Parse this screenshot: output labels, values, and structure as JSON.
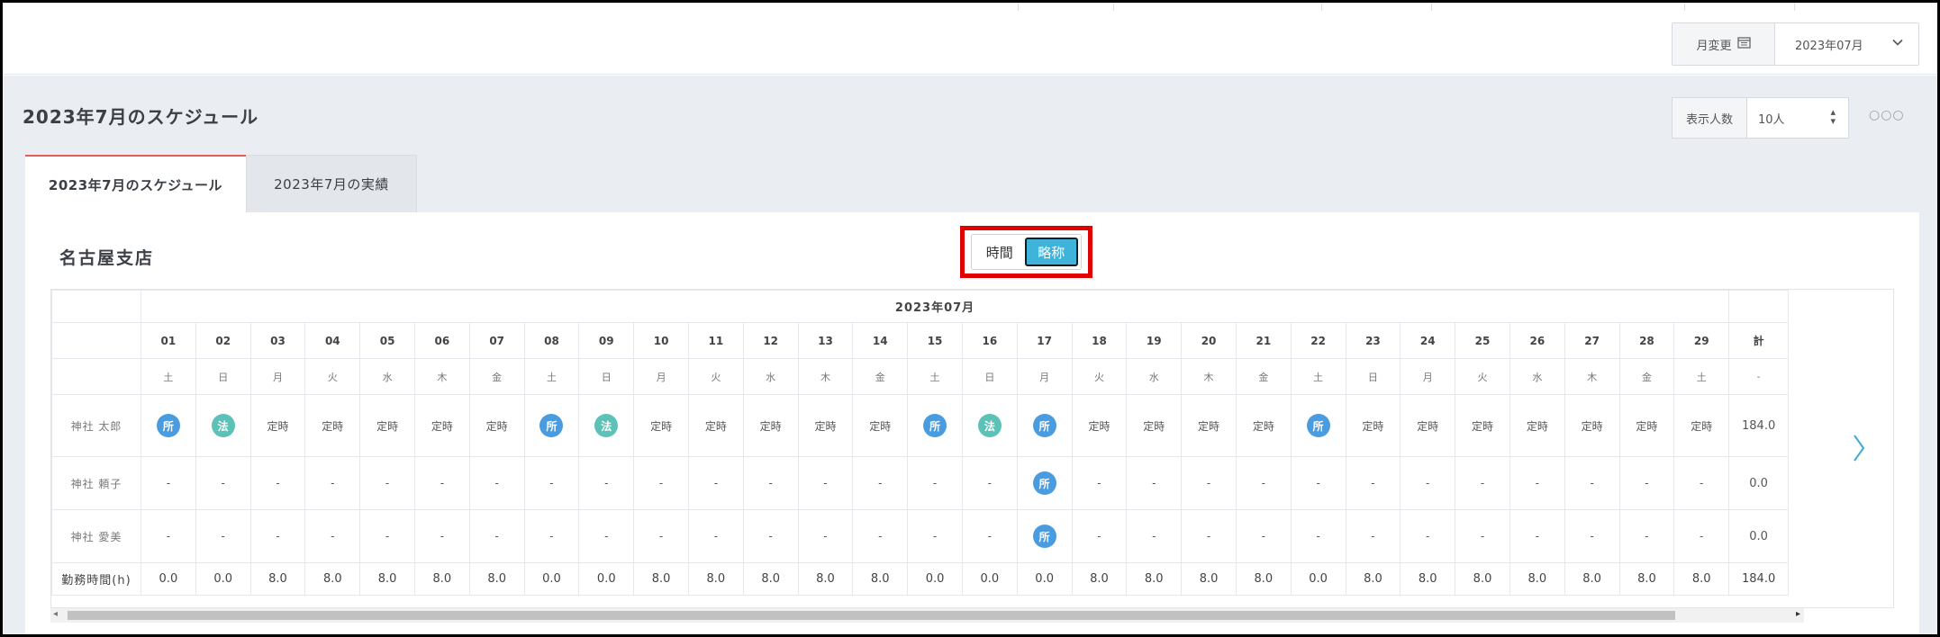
{
  "month_selector": {
    "label": "月変更",
    "value": "2023年07月"
  },
  "panel": {
    "title": "2023年7月のスケジュール"
  },
  "display_count": {
    "label": "表示人数",
    "value": "10人"
  },
  "tabs": [
    {
      "label": "2023年7月のスケジュール",
      "active": true
    },
    {
      "label": "2023年7月の実績",
      "active": false
    }
  ],
  "branch_name": "名古屋支店",
  "toggle": {
    "time_label": "時間",
    "abbr_label": "略称",
    "selected": "略称"
  },
  "table": {
    "month_header": "2023年07月",
    "total_header": "計",
    "days": [
      "01",
      "02",
      "03",
      "04",
      "05",
      "06",
      "07",
      "08",
      "09",
      "10",
      "11",
      "12",
      "13",
      "14",
      "15",
      "16",
      "17",
      "18",
      "19",
      "20",
      "21",
      "22",
      "23",
      "24",
      "25",
      "26",
      "27",
      "28",
      "29"
    ],
    "weekdays": [
      "土",
      "日",
      "月",
      "火",
      "水",
      "木",
      "金",
      "土",
      "日",
      "月",
      "火",
      "水",
      "木",
      "金",
      "土",
      "日",
      "月",
      "火",
      "水",
      "木",
      "金",
      "土",
      "日",
      "月",
      "火",
      "水",
      "木",
      "金",
      "土"
    ],
    "weekday_total": "-",
    "rows": [
      {
        "name": "神社 太郎",
        "cells": [
          "所",
          "法",
          "定時",
          "定時",
          "定時",
          "定時",
          "定時",
          "所",
          "法",
          "定時",
          "定時",
          "定時",
          "定時",
          "定時",
          "所",
          "法",
          "所",
          "定時",
          "定時",
          "定時",
          "定時",
          "所",
          "定時",
          "定時",
          "定時",
          "定時",
          "定時",
          "定時",
          "定時"
        ],
        "total": "184.0"
      },
      {
        "name": "神社 頼子",
        "cells": [
          "-",
          "-",
          "-",
          "-",
          "-",
          "-",
          "-",
          "-",
          "-",
          "-",
          "-",
          "-",
          "-",
          "-",
          "-",
          "-",
          "所",
          "-",
          "-",
          "-",
          "-",
          "-",
          "-",
          "-",
          "-",
          "-",
          "-",
          "-",
          "-"
        ],
        "total": "0.0"
      },
      {
        "name": "神社 愛美",
        "cells": [
          "-",
          "-",
          "-",
          "-",
          "-",
          "-",
          "-",
          "-",
          "-",
          "-",
          "-",
          "-",
          "-",
          "-",
          "-",
          "-",
          "所",
          "-",
          "-",
          "-",
          "-",
          "-",
          "-",
          "-",
          "-",
          "-",
          "-",
          "-",
          "-"
        ],
        "total": "0.0"
      }
    ],
    "hours_row": {
      "label": "勤務時間(h)",
      "values": [
        "0.0",
        "0.0",
        "8.0",
        "8.0",
        "8.0",
        "8.0",
        "8.0",
        "0.0",
        "0.0",
        "8.0",
        "8.0",
        "8.0",
        "8.0",
        "8.0",
        "0.0",
        "0.0",
        "0.0",
        "8.0",
        "8.0",
        "8.0",
        "8.0",
        "0.0",
        "8.0",
        "8.0",
        "8.0",
        "8.0",
        "8.0",
        "8.0",
        "8.0"
      ],
      "total": "184.0"
    }
  },
  "colors": {
    "badge_sho": "#4a9ce0",
    "badge_ho": "#5cc2b8",
    "toggle_on": "#3fb3d9",
    "highlight": "#e00000",
    "tab_accent": "#e35b5b"
  }
}
